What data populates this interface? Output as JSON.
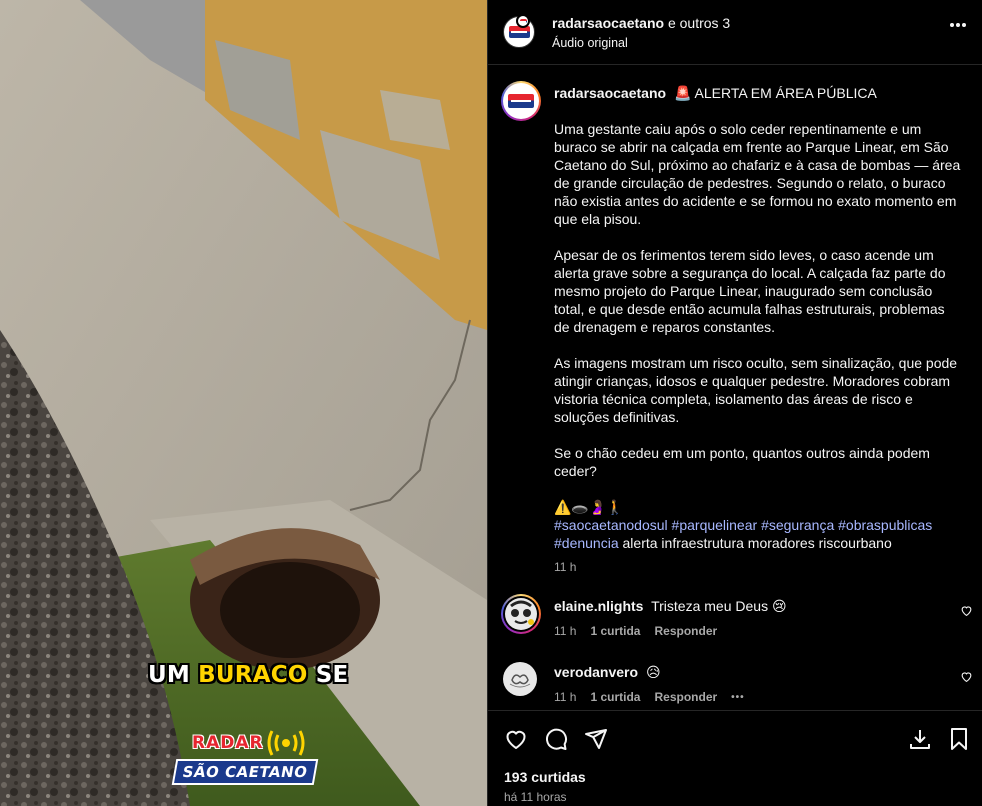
{
  "media": {
    "caption_part1": "UM ",
    "caption_highlight": "BURACO",
    "caption_part2": " SE",
    "logo_top": "RADAR",
    "logo_bottom": "SÃO CAETANO"
  },
  "header": {
    "username": "radarsaocaetano",
    "coauthors": "e outros 3",
    "audio": "Áudio original",
    "more_icon": "more-horizontal-icon"
  },
  "post": {
    "username": "radarsaocaetano",
    "headline": "🚨 ALERTA EM ÁREA PÚBLICA",
    "paragraphs": [
      "Uma gestante caiu após o solo ceder repentinamente e um buraco se abrir na calçada em frente ao Parque Linear, em São Caetano do Sul, próximo ao chafariz e à casa de bombas — área de grande circulação de pedestres. Segundo o relato, o buraco não existia antes do acidente e se formou no exato momento em que ela pisou.",
      "Apesar de os ferimentos terem sido leves, o caso acende um alerta grave sobre a segurança do local. A calçada faz parte do mesmo projeto do Parque Linear, inaugurado sem conclusão total, e que desde então acumula falhas estruturais, problemas de drenagem e reparos constantes.",
      "As imagens mostram um risco oculto, sem sinalização, que pode atingir crianças, idosos e qualquer pedestre. Moradores cobram vistoria técnica completa, isolamento das áreas de risco e soluções definitivas.",
      "Se o chão cedeu em um ponto, quantos outros ainda podem ceder?"
    ],
    "emojis": "⚠️🕳️🤰🚶",
    "hashtags": [
      "#saocaetanodosul",
      "#parquelinear",
      "#segurança",
      "#obraspublicas",
      "#denuncia"
    ],
    "plain_tags": "alerta infraestrutura moradores riscourbano",
    "time": "11 h"
  },
  "comments": [
    {
      "username": "elaine.nlights",
      "text": "Tristeza meu Deus 😢",
      "time": "11 h",
      "likes": "1 curtida",
      "reply": "Responder",
      "more": ""
    },
    {
      "username": "verodanvero",
      "text": "😥",
      "time": "11 h",
      "likes": "1 curtida",
      "reply": "Responder",
      "more": "•••"
    }
  ],
  "footer": {
    "likes": "193 curtidas",
    "posted": "há 11 horas"
  },
  "colors": {
    "background": "#000000",
    "link": "#a8b8ff",
    "muted": "#a8a8a8",
    "caption_highlight": "#ffd400"
  }
}
